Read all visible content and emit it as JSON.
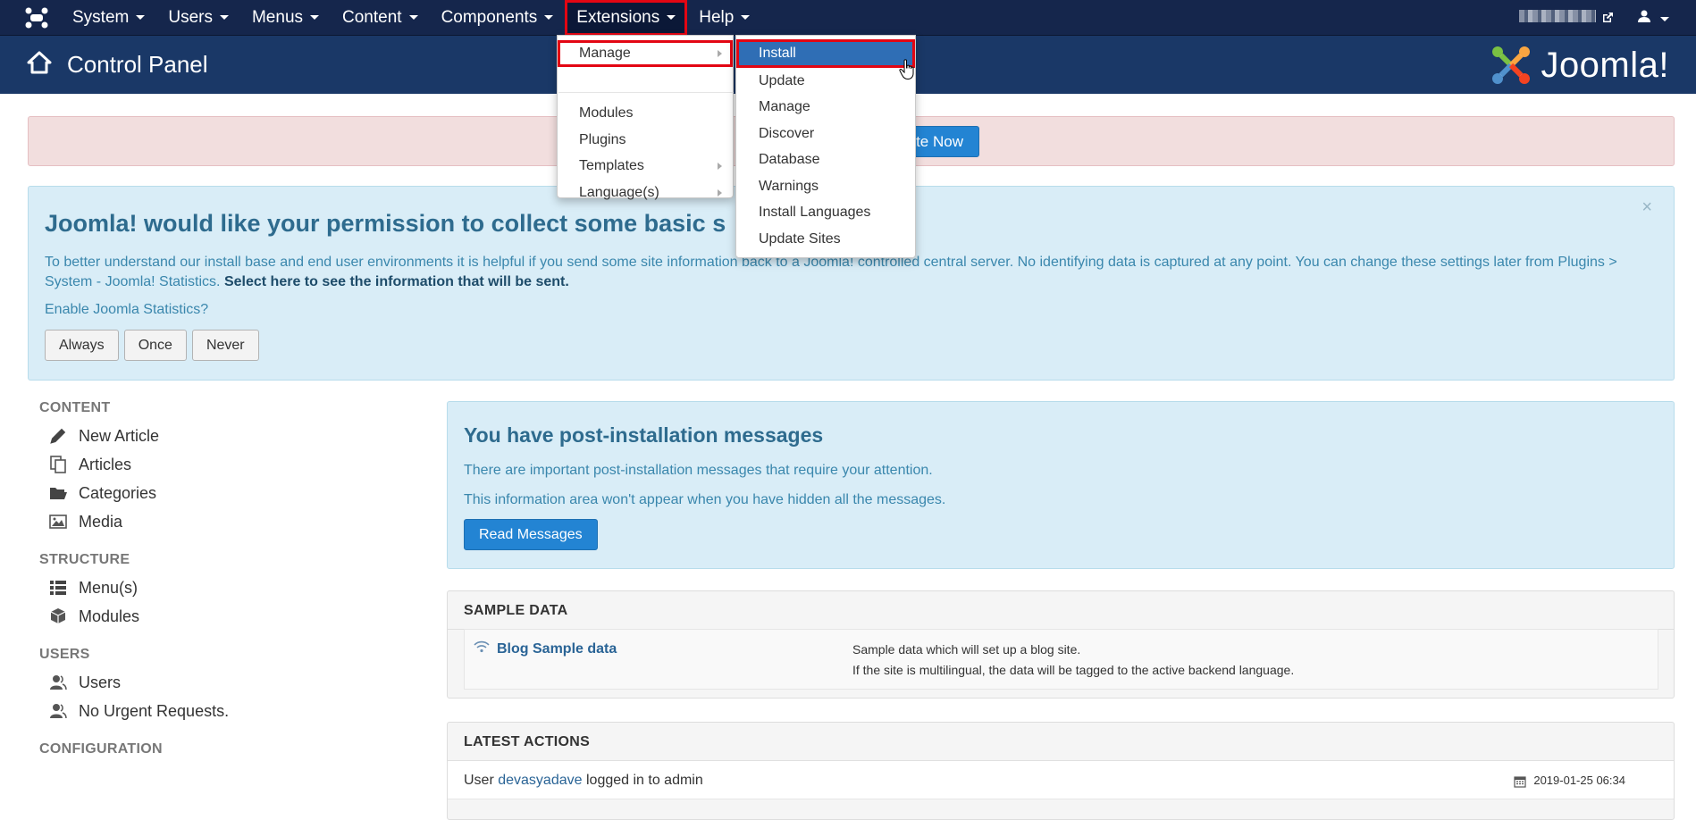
{
  "topnav": {
    "items": [
      {
        "label": "System"
      },
      {
        "label": "Users"
      },
      {
        "label": "Menus"
      },
      {
        "label": "Content"
      },
      {
        "label": "Components"
      },
      {
        "label": "Extensions"
      },
      {
        "label": "Help"
      }
    ]
  },
  "header": {
    "title": "Control Panel",
    "brand": "Joomla!"
  },
  "update_alert": {
    "button_label": "ate Now"
  },
  "stats": {
    "title": "Joomla! would like your permission to collect some basic s",
    "text": "To better understand our install base and end user environments it is helpful if you send some site information back to a Joomla! controlled central server. No identifying data is captured at any point. You can change these settings later from Plugins > System - Joomla! Statistics.",
    "link": "Select here to see the information that will be sent.",
    "enable_label": "Enable Joomla Statistics?",
    "buttons": [
      "Always",
      "Once",
      "Never"
    ],
    "close": "×"
  },
  "sidebar": {
    "sections": [
      {
        "heading": "CONTENT",
        "links": [
          "New Article",
          "Articles",
          "Categories",
          "Media"
        ]
      },
      {
        "heading": "STRUCTURE",
        "links": [
          "Menu(s)",
          "Modules"
        ]
      },
      {
        "heading": "USERS",
        "links": [
          "Users",
          "No Urgent Requests."
        ]
      },
      {
        "heading": "CONFIGURATION",
        "links": []
      }
    ]
  },
  "post_install": {
    "title": "You have post-installation messages",
    "line1": "There are important post-installation messages that require your attention.",
    "line2": "This information area won't appear when you have hidden all the messages.",
    "button": "Read Messages"
  },
  "sample_data": {
    "heading": "SAMPLE DATA",
    "name": "Blog Sample data",
    "desc1": "Sample data which will set up a blog site.",
    "desc2": "If the site is multilingual, the data will be tagged to the active backend language."
  },
  "latest_actions": {
    "heading": "LATEST ACTIONS",
    "prefix": "User",
    "user": "devasyadave",
    "suffix": "logged in to admin",
    "date": "2019-01-25 06:34"
  },
  "extensions_menu": {
    "items": [
      "Manage",
      "Modules",
      "Plugins",
      "Templates",
      "Language(s)"
    ]
  },
  "manage_submenu": {
    "items": [
      "Install",
      "Update",
      "Manage",
      "Discover",
      "Database",
      "Warnings",
      "Install Languages",
      "Update Sites"
    ]
  },
  "colors": {
    "topbar": "#15264c",
    "header": "#1a3867",
    "highlight": "#e30613",
    "primary_button": "#2384d3",
    "info_bg": "#d9edf7"
  }
}
